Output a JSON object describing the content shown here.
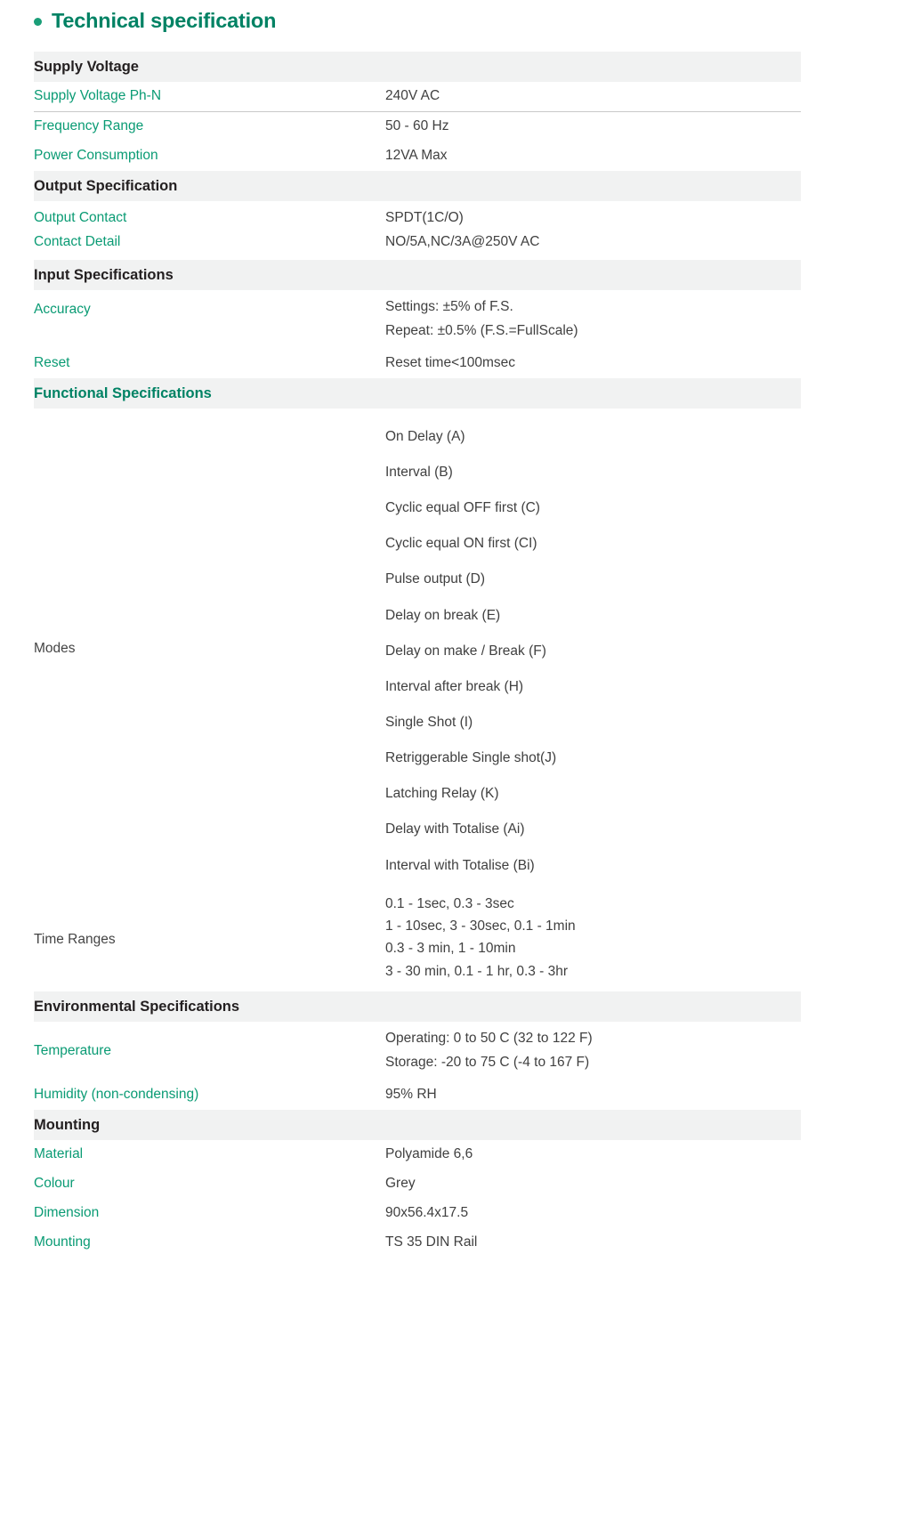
{
  "header": {
    "bullet_icon": "bullet-dot-icon",
    "title": "Technical specification",
    "accent_color": "#008264",
    "bullet_color": "#1a9e78"
  },
  "sections": [
    {
      "id": "supply-voltage",
      "heading": "Supply Voltage",
      "heading_style": "dark",
      "rows": [
        {
          "label": "Supply Voltage Ph-N",
          "values": [
            "240V AC"
          ]
        },
        {
          "label": "Frequency Range",
          "values": [
            "50 - 60 Hz"
          ]
        },
        {
          "label": "Power Consumption",
          "values": [
            "12VA Max"
          ]
        }
      ]
    },
    {
      "id": "output-specification",
      "heading": "Output Specification",
      "heading_style": "dark",
      "rows": [
        {
          "label": "Output Contact",
          "values": [
            "SPDT(1C/O)"
          ]
        },
        {
          "label": "Contact Detail",
          "values": [
            "NO/5A,NC/3A@250V AC"
          ]
        }
      ]
    },
    {
      "id": "input-specifications",
      "heading": "Input Specifications",
      "heading_style": "dark",
      "rows": [
        {
          "label": "Accuracy",
          "values": [
            "Settings: ±5% of F.S.",
            "Repeat: ±0.5% (F.S.=FullScale)"
          ]
        },
        {
          "label": "Reset",
          "values": [
            "Reset time<100msec"
          ]
        }
      ]
    },
    {
      "id": "functional-specifications",
      "heading": "Functional Specifications",
      "heading_style": "teal",
      "rows": []
    },
    {
      "id": "environmental-specifications",
      "heading": "Environmental Specifications",
      "heading_style": "dark",
      "rows": [
        {
          "label": "Temperature",
          "values": [
            "Operating: 0 to 50 C (32 to 122 F)",
            "Storage: -20 to 75 C (-4 to 167 F)"
          ]
        },
        {
          "label": "Humidity (non-condensing)",
          "values": [
            "95% RH"
          ]
        }
      ]
    },
    {
      "id": "mounting",
      "heading": "Mounting",
      "heading_style": "dark",
      "rows": [
        {
          "label": "Material",
          "values": [
            "Polyamide 6,6"
          ]
        },
        {
          "label": "Colour",
          "values": [
            "Grey"
          ]
        },
        {
          "label": "Dimension",
          "values": [
            "90x56.4x17.5"
          ]
        },
        {
          "label": "Mounting",
          "values": [
            "TS 35 DIN Rail"
          ]
        }
      ]
    }
  ],
  "modes": {
    "label": "Modes",
    "items": [
      "On Delay (A)",
      "Interval (B)",
      "Cyclic equal OFF first (C)",
      "Cyclic equal ON first (CI)",
      "Pulse output (D)",
      "Delay on break (E)",
      "Delay on make / Break (F)",
      "Interval after break (H)",
      "Single Shot (I)",
      "Retriggerable Single shot(J)",
      "Latching Relay (K)",
      "Delay with Totalise (Ai)",
      "Interval with Totalise (Bi)"
    ]
  },
  "time_ranges": {
    "label": "Time Ranges",
    "lines": [
      "0.1 - 1sec, 0.3 - 3sec",
      "1 - 10sec, 3 - 30sec, 0.1 - 1min",
      "0.3 - 3 min, 1 - 10min",
      "3 - 30 min, 0.1 - 1 hr, 0.3 - 3hr"
    ]
  }
}
